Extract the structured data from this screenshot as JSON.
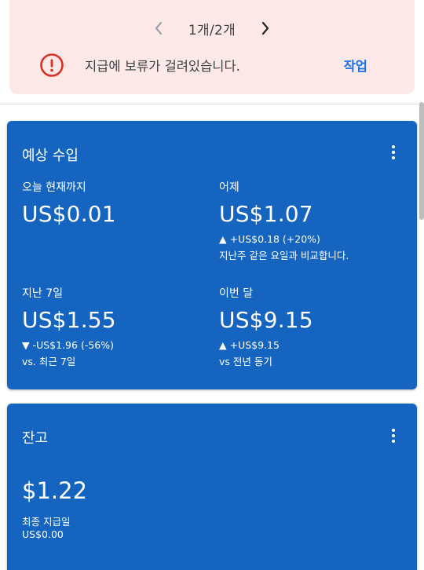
{
  "alert": {
    "pager_text": "1개/2개",
    "message": "지급에 보류가 걸려있습니다.",
    "action_label": "작업",
    "colors": {
      "background": "#fce8e6",
      "error": "#d93025",
      "link": "#1a73e8"
    },
    "icons": {
      "prev": "chevron-left-icon",
      "next": "chevron-right-icon",
      "error": "error-circle-icon"
    }
  },
  "estimated_earnings": {
    "title": "예상 수입",
    "color": "#1565c0",
    "today": {
      "label": "오늘 현재까지",
      "value": "US$0.01"
    },
    "yesterday": {
      "label": "어제",
      "value": "US$1.07",
      "change": "▲ +US$0.18 (+20%)",
      "note": "지난주 같은 요일과 비교합니다."
    },
    "last7": {
      "label": "지난 7일",
      "value": "US$1.55",
      "change": "▼ -US$1.96 (-56%)",
      "note": "vs. 최근 7일"
    },
    "this_month": {
      "label": "이번 달",
      "value": "US$9.15",
      "change": "▲ +US$9.15",
      "note": "vs 전년 동기"
    }
  },
  "balance": {
    "title": "잔고",
    "value": "$1.22",
    "last_payment_label": "최종 지급일",
    "last_payment_value": "US$0.00"
  }
}
